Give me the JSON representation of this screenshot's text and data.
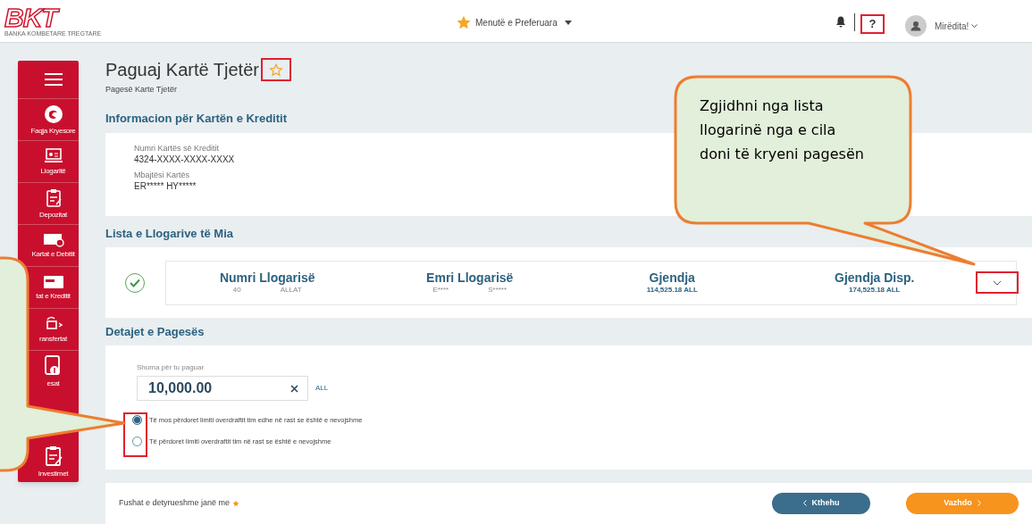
{
  "header": {
    "logo": {
      "text": "BKT",
      "tagline": "BANKA KOMBETARE TREGTARE"
    },
    "favorites_menu": {
      "label": "Menutë e Preferuara"
    },
    "help": {
      "label": "?",
      "highlighted": true
    },
    "greeting": "Mirëdita!"
  },
  "sidebar": {
    "items": [
      {
        "kind": "menu"
      },
      {
        "kind": "home",
        "label": "Faqja Kryesore"
      },
      {
        "kind": "accounts",
        "label": "Llogaritë"
      },
      {
        "kind": "deposits",
        "label": "Depozitat"
      },
      {
        "kind": "debit",
        "label": "Kartat e Debitit"
      },
      {
        "kind": "credit",
        "label": "tat e Kreditit"
      },
      {
        "kind": "transfers",
        "label": "ransfertat"
      },
      {
        "kind": "payments",
        "label": "esat"
      },
      {
        "kind": "investments",
        "label": "Investimet"
      }
    ]
  },
  "page": {
    "title": "Paguaj Kartë Tjetër",
    "favorite": {
      "highlighted": true
    },
    "subtitle": "Pagesë Karte Tjetër"
  },
  "card_info": {
    "heading": "Informacion për Kartën e Kreditit",
    "fields": [
      {
        "label": "Numri Kartës së Kreditit",
        "value": "4324-XXXX-XXXX-XXXX"
      },
      {
        "label": "Mbajtësi Kartës",
        "value": "ER***** HY*****"
      }
    ]
  },
  "accounts": {
    "heading": "Lista e Llogarive të Mia",
    "rows": [
      {
        "selected": true,
        "expand_highlighted": true,
        "columns": [
          {
            "header": "Numri Llogarisë",
            "values": [
              "40",
              "ALLAT"
            ]
          },
          {
            "header": "Emri Llogarisë",
            "values": [
              "E****",
              "S*****"
            ]
          },
          {
            "header": "Gjendja",
            "values": [
              "114,525.18 ALL"
            ]
          },
          {
            "header": "Gjendja Disp.",
            "values": [
              "174,525.18 ALL"
            ]
          }
        ]
      }
    ]
  },
  "payment": {
    "heading": "Detajet e Pagesës",
    "amount": {
      "label": "Shuma për tu paguar",
      "value": "10,000.00",
      "currency": "ALL"
    },
    "options_highlighted": true,
    "options": [
      {
        "label": "Të mos përdoret limiti overdraftit tim edhe në rast se është e nevojshme",
        "selected": true
      },
      {
        "label": "Të përdoret limiti overdraftit tim në rast se është e nevojshme",
        "selected": false
      }
    ]
  },
  "footer": {
    "required_note": "Fushat e detyrueshme janë me",
    "buttons": [
      {
        "kind": "back",
        "label": "Kthehu"
      },
      {
        "kind": "next",
        "label": "Vazhdo"
      }
    ]
  },
  "callouts": {
    "account": {
      "text": "Zgjidhni nga lista llogarinë nga e cila doni të kryeni pagesën"
    },
    "overdraft": true
  }
}
